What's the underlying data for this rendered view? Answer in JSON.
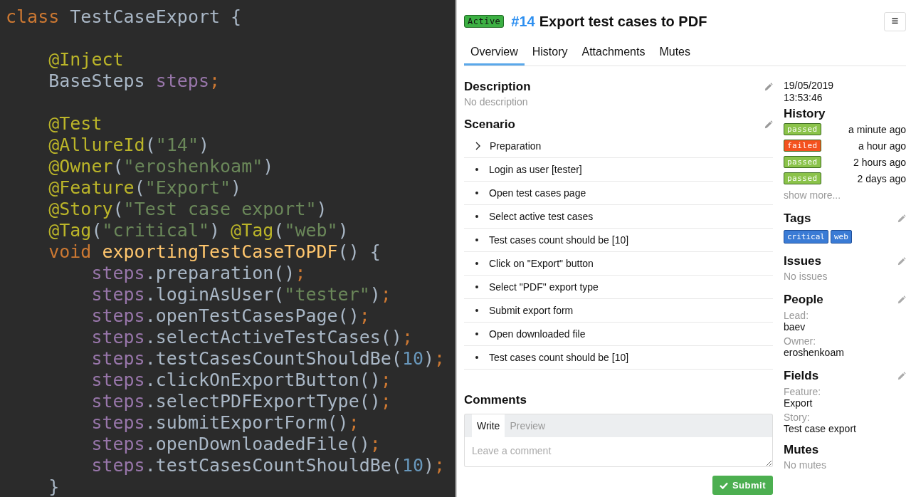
{
  "editor": {
    "lines": [
      {
        "kind": "code",
        "tokens": [
          {
            "kind": "keyword",
            "text": "class "
          },
          {
            "kind": "plain",
            "text": "TestCaseExport {"
          }
        ]
      },
      {
        "kind": "blank"
      },
      {
        "kind": "code",
        "tokens": [
          {
            "kind": "annotation",
            "text": "    @Inject"
          }
        ]
      },
      {
        "kind": "code",
        "tokens": [
          {
            "kind": "plain",
            "text": "    BaseSteps "
          },
          {
            "kind": "field",
            "text": "steps"
          },
          {
            "kind": "punct",
            "text": ";"
          }
        ]
      },
      {
        "kind": "blank"
      },
      {
        "kind": "code",
        "tokens": [
          {
            "kind": "annotation",
            "text": "    @Test"
          }
        ]
      },
      {
        "kind": "code",
        "tokens": [
          {
            "kind": "annotation",
            "text": "    @AllureId"
          },
          {
            "kind": "plain",
            "text": "("
          },
          {
            "kind": "string",
            "text": "\"14\""
          },
          {
            "kind": "plain",
            "text": ")"
          }
        ]
      },
      {
        "kind": "code",
        "tokens": [
          {
            "kind": "annotation",
            "text": "    @Owner"
          },
          {
            "kind": "plain",
            "text": "("
          },
          {
            "kind": "string",
            "text": "\"eroshenkoam\""
          },
          {
            "kind": "plain",
            "text": ")"
          }
        ]
      },
      {
        "kind": "code",
        "tokens": [
          {
            "kind": "annotation",
            "text": "    @Feature"
          },
          {
            "kind": "plain",
            "text": "("
          },
          {
            "kind": "string",
            "text": "\"Export\""
          },
          {
            "kind": "plain",
            "text": ")"
          }
        ]
      },
      {
        "kind": "code",
        "tokens": [
          {
            "kind": "annotation",
            "text": "    @Story"
          },
          {
            "kind": "plain",
            "text": "("
          },
          {
            "kind": "string",
            "text": "\"Test case export\""
          },
          {
            "kind": "plain",
            "text": ")"
          }
        ]
      },
      {
        "kind": "code",
        "tokens": [
          {
            "kind": "annotation",
            "text": "    @Tag"
          },
          {
            "kind": "plain",
            "text": "("
          },
          {
            "kind": "string",
            "text": "\"critical\""
          },
          {
            "kind": "plain",
            "text": ") "
          },
          {
            "kind": "annotation",
            "text": "@Tag"
          },
          {
            "kind": "plain",
            "text": "("
          },
          {
            "kind": "string",
            "text": "\"web\""
          },
          {
            "kind": "plain",
            "text": ")"
          }
        ]
      },
      {
        "kind": "code",
        "tokens": [
          {
            "kind": "keyword",
            "text": "    void "
          },
          {
            "kind": "method",
            "text": "exportingTestCaseToPDF"
          },
          {
            "kind": "plain",
            "text": "() {"
          }
        ]
      },
      {
        "kind": "code",
        "tokens": [
          {
            "kind": "field",
            "text": "        steps"
          },
          {
            "kind": "plain",
            "text": ".preparation()"
          },
          {
            "kind": "punct",
            "text": ";"
          }
        ]
      },
      {
        "kind": "code",
        "tokens": [
          {
            "kind": "field",
            "text": "        steps"
          },
          {
            "kind": "plain",
            "text": ".loginAsUser("
          },
          {
            "kind": "string",
            "text": "\"tester\""
          },
          {
            "kind": "plain",
            "text": ")"
          },
          {
            "kind": "punct",
            "text": ";"
          }
        ]
      },
      {
        "kind": "code",
        "tokens": [
          {
            "kind": "field",
            "text": "        steps"
          },
          {
            "kind": "plain",
            "text": ".openTestCasesPage()"
          },
          {
            "kind": "punct",
            "text": ";"
          }
        ]
      },
      {
        "kind": "code",
        "tokens": [
          {
            "kind": "field",
            "text": "        steps"
          },
          {
            "kind": "plain",
            "text": ".selectActiveTestCases()"
          },
          {
            "kind": "punct",
            "text": ";"
          }
        ]
      },
      {
        "kind": "code",
        "tokens": [
          {
            "kind": "field",
            "text": "        steps"
          },
          {
            "kind": "plain",
            "text": ".testCasesCountShouldBe("
          },
          {
            "kind": "number",
            "text": "10"
          },
          {
            "kind": "plain",
            "text": ")"
          },
          {
            "kind": "punct",
            "text": ";"
          }
        ]
      },
      {
        "kind": "code",
        "tokens": [
          {
            "kind": "field",
            "text": "        steps"
          },
          {
            "kind": "plain",
            "text": ".clickOnExportButton()"
          },
          {
            "kind": "punct",
            "text": ";"
          }
        ]
      },
      {
        "kind": "code",
        "tokens": [
          {
            "kind": "field",
            "text": "        steps"
          },
          {
            "kind": "plain",
            "text": ".selectPDFExportType()"
          },
          {
            "kind": "punct",
            "text": ";"
          }
        ]
      },
      {
        "kind": "code",
        "tokens": [
          {
            "kind": "field",
            "text": "        steps"
          },
          {
            "kind": "plain",
            "text": ".submitExportForm()"
          },
          {
            "kind": "punct",
            "text": ";"
          }
        ]
      },
      {
        "kind": "code",
        "tokens": [
          {
            "kind": "field",
            "text": "        steps"
          },
          {
            "kind": "plain",
            "text": ".openDownloadedFile()"
          },
          {
            "kind": "punct",
            "text": ";"
          }
        ]
      },
      {
        "kind": "code",
        "tokens": [
          {
            "kind": "field",
            "text": "        steps"
          },
          {
            "kind": "plain",
            "text": ".testCasesCountShouldBe("
          },
          {
            "kind": "number",
            "text": "10"
          },
          {
            "kind": "plain",
            "text": ")"
          },
          {
            "kind": "punct",
            "text": ";"
          }
        ]
      },
      {
        "kind": "code",
        "tokens": [
          {
            "kind": "plain",
            "text": "    }"
          }
        ]
      }
    ]
  },
  "test_case": {
    "status": "Active",
    "id": "#14",
    "title": "Export test cases to PDF",
    "menu": "≡",
    "tabs": [
      {
        "label": "Overview",
        "selected": true
      },
      {
        "label": "History",
        "selected": false
      },
      {
        "label": "Attachments",
        "selected": false
      },
      {
        "label": "Mutes",
        "selected": false
      }
    ],
    "description": {
      "title": "Description",
      "text": "No description"
    },
    "scenario": {
      "title": "Scenario",
      "steps": [
        {
          "kind": "group",
          "text": "Preparation"
        },
        {
          "kind": "step",
          "text": "Login as user [tester]"
        },
        {
          "kind": "step",
          "text": "Open test cases page"
        },
        {
          "kind": "step",
          "text": "Select active test cases"
        },
        {
          "kind": "step",
          "text": "Test cases count should be [10]"
        },
        {
          "kind": "step",
          "text": "Click on \"Export\" button"
        },
        {
          "kind": "step",
          "text": "Select \"PDF\" export type"
        },
        {
          "kind": "step",
          "text": "Submit export form"
        },
        {
          "kind": "step",
          "text": "Open downloaded file"
        },
        {
          "kind": "step",
          "text": "Test cases count should be [10]"
        }
      ]
    },
    "comments": {
      "title": "Comments",
      "tabs": [
        {
          "label": "Write",
          "selected": true
        },
        {
          "label": "Preview",
          "selected": false
        }
      ],
      "placeholder": "Leave a comment",
      "submit": "Submit"
    },
    "sidebar": {
      "date": "19/05/2019",
      "time": "13:53:46",
      "history": {
        "title": "History",
        "runs": [
          {
            "status": "passed",
            "color": "#8bc34a",
            "when": "a minute ago"
          },
          {
            "status": "failed",
            "color": "#f4511e",
            "when": "a hour ago"
          },
          {
            "status": "passed",
            "color": "#8bc34a",
            "when": "2 hours ago"
          },
          {
            "status": "passed",
            "color": "#8bc34a",
            "when": "2 days ago"
          }
        ],
        "more": "show more..."
      },
      "tags": {
        "title": "Tags",
        "items": [
          "critical",
          "web"
        ]
      },
      "issues": {
        "title": "Issues",
        "empty": "No issues"
      },
      "people": {
        "title": "People",
        "fields": [
          {
            "label": "Lead:",
            "value": "baev"
          },
          {
            "label": "Owner:",
            "value": "eroshenkoam"
          }
        ]
      },
      "fields": {
        "title": "Fields",
        "fields": [
          {
            "label": "Feature:",
            "value": "Export"
          },
          {
            "label": "Story:",
            "value": "Test case export"
          }
        ]
      },
      "mutes": {
        "title": "Mutes",
        "empty": "No mutes"
      }
    }
  }
}
